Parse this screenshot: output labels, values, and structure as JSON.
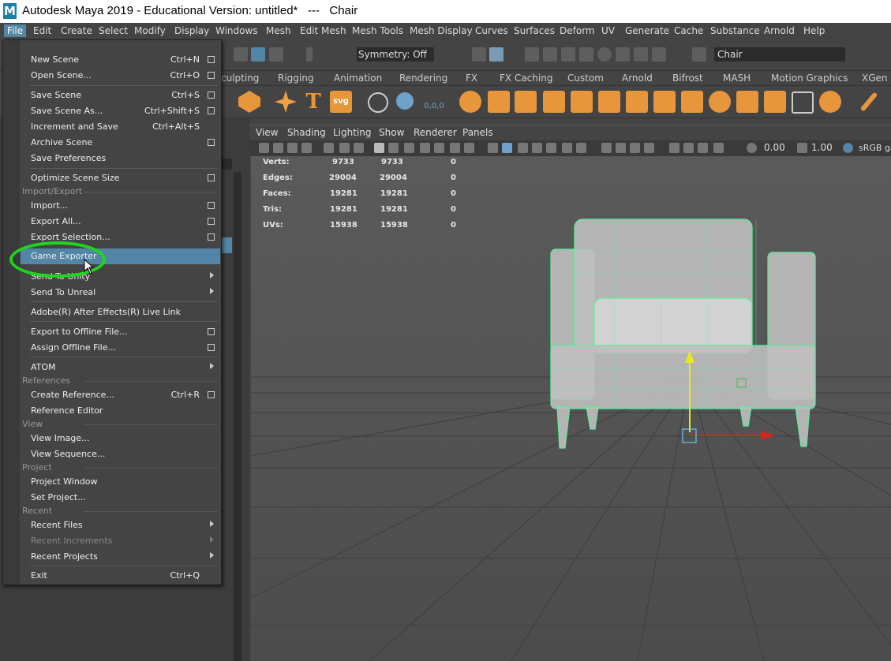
{
  "window": {
    "title": "Autodesk Maya 2019 - Educational Version: untitled*   ---   Chair",
    "logo": "M"
  },
  "menubar": [
    "File",
    "Edit",
    "Create",
    "Select",
    "Modify",
    "Display",
    "Windows",
    "Mesh",
    "Edit Mesh",
    "Mesh Tools",
    "Mesh Display",
    "Curves",
    "Surfaces",
    "Deform",
    "UV",
    "Generate",
    "Cache",
    "Substance",
    "Arnold",
    "Help"
  ],
  "status": {
    "symmetry": "Symmetry: Off",
    "object_name": "Chair"
  },
  "shelf_tabs": [
    "culpting",
    "Rigging",
    "Animation",
    "Rendering",
    "FX",
    "FX Caching",
    "Custom",
    "Arnold",
    "Bifrost",
    "MASH",
    "Motion Graphics",
    "XGen"
  ],
  "viewport_menu": [
    "View",
    "Shading",
    "Lighting",
    "Show",
    "Renderer",
    "Panels"
  ],
  "viewport_tools": {
    "exposure": "0.00",
    "gamma": "1.00",
    "colorspace": "sRGB ga"
  },
  "hud": [
    {
      "label": "Verts:",
      "a": "9733",
      "b": "9733",
      "c": "0"
    },
    {
      "label": "Edges:",
      "a": "29004",
      "b": "29004",
      "c": "0"
    },
    {
      "label": "Faces:",
      "a": "19281",
      "b": "19281",
      "c": "0"
    },
    {
      "label": "Tris:",
      "a": "19281",
      "b": "19281",
      "c": "0"
    },
    {
      "label": "UVs:",
      "a": "15938",
      "b": "15938",
      "c": "0"
    }
  ],
  "file_menu": {
    "new_scene": {
      "label": "New Scene",
      "shortcut": "Ctrl+N"
    },
    "open_scene": {
      "label": "Open Scene...",
      "shortcut": "Ctrl+O"
    },
    "save_scene": {
      "label": "Save Scene",
      "shortcut": "Ctrl+S"
    },
    "save_scene_as": {
      "label": "Save Scene As...",
      "shortcut": "Ctrl+Shift+S"
    },
    "increment_save": {
      "label": "Increment and Save",
      "shortcut": "Ctrl+Alt+S"
    },
    "archive_scene": {
      "label": "Archive Scene"
    },
    "save_preferences": {
      "label": "Save Preferences"
    },
    "optimize_scene": {
      "label": "Optimize Scene Size"
    },
    "section_import_export": "Import/Export",
    "import": {
      "label": "Import..."
    },
    "export_all": {
      "label": "Export All..."
    },
    "export_selection": {
      "label": "Export Selection..."
    },
    "game_exporter": {
      "label": "Game Exporter"
    },
    "send_to_unity": {
      "label": "Send To Unity"
    },
    "send_to_unreal": {
      "label": "Send To Unreal"
    },
    "after_effects": {
      "label": "Adobe(R) After Effects(R) Live Link"
    },
    "export_offline": {
      "label": "Export to Offline File..."
    },
    "assign_offline": {
      "label": "Assign Offline File..."
    },
    "atom": {
      "label": "ATOM"
    },
    "section_references": "References",
    "create_reference": {
      "label": "Create Reference...",
      "shortcut": "Ctrl+R"
    },
    "reference_editor": {
      "label": "Reference Editor"
    },
    "section_view": "View",
    "view_image": {
      "label": "View Image..."
    },
    "view_sequence": {
      "label": "View Sequence..."
    },
    "section_project": "Project",
    "project_window": {
      "label": "Project Window"
    },
    "set_project": {
      "label": "Set Project..."
    },
    "section_recent": "Recent",
    "recent_files": {
      "label": "Recent Files"
    },
    "recent_increments": {
      "label": "Recent Increments"
    },
    "recent_projects": {
      "label": "Recent Projects"
    },
    "exit": {
      "label": "Exit",
      "shortcut": "Ctrl+Q"
    }
  },
  "colors": {
    "highlight": "#5285a6",
    "annotation_circle": "#1ed61e",
    "wireframe": "#5cf09a"
  }
}
